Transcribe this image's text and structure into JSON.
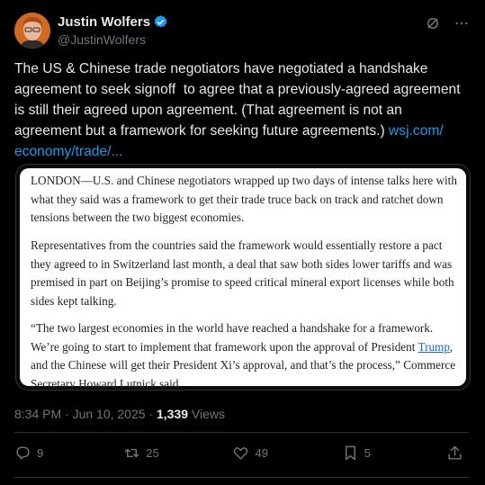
{
  "author": {
    "display_name": "Justin Wolfers",
    "handle": "@JustinWolfers",
    "avatar_icon": "avatar",
    "verified_icon": "verified-badge-icon"
  },
  "tweet": {
    "text": "The US & Chinese trade negotiators have negotiated a handshake agreement to seek signoff  to agree that a previously-agreed agreement is still their agreed upon agreement. (That agreement is not an agreement but a framework for seeking future agreements.) ",
    "link_text": "wsj.com/\neconomy/trade/..."
  },
  "article": {
    "p1": "LONDON—U.S. and Chinese negotiators wrapped up two days of intense talks here with what they said was a framework to get their trade truce back on track and ratchet down tensions between the two biggest economies.",
    "p2": "Representatives from the countries said the framework would essentially restore a pact they agreed to in Switzerland last month, a deal that saw both sides lower tariffs and was premised in part on Beijing’s promise to speed critical mineral export licenses while both sides kept talking.",
    "p3_before": "“The two largest economies in the world have reached a handshake for a framework. We’re going to start to implement that framework upon the approval of President ",
    "p3_link": "Trump",
    "p3_after": ", and the Chinese will get their President Xi’s approval, and that’s the process,” Commerce Secretary Howard Lutnick said."
  },
  "meta": {
    "timestamp": "8:34 PM · Jun 10, 2025 · ",
    "views_count": "1,339",
    "views_label": " Views"
  },
  "actions": {
    "replies": "9",
    "reposts": "25",
    "likes": "49",
    "bookmarks": "5"
  },
  "colors": {
    "background": "#000000",
    "text": "#e7e9ea",
    "muted": "#71767b",
    "link": "#1d9bf0",
    "verified": "#1d9bf0"
  }
}
